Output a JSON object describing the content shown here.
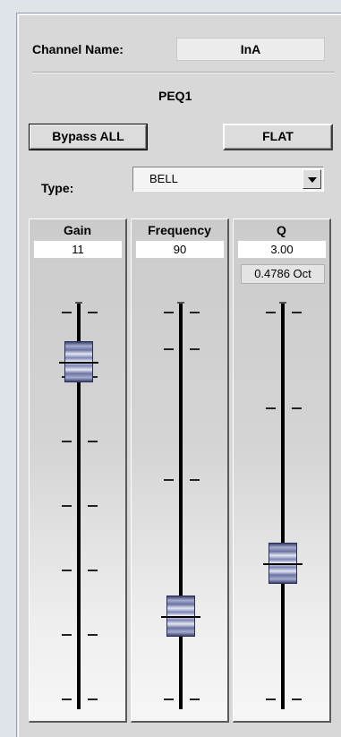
{
  "channel": {
    "label": "Channel  Name:",
    "value": "InA"
  },
  "section_title": "PEQ1",
  "buttons": {
    "bypass": "Bypass ALL",
    "flat": "FLAT"
  },
  "type": {
    "label": "Type:",
    "value": "BELL"
  },
  "faders": {
    "gain": {
      "title": "Gain",
      "value": "11",
      "level_fraction": 0.82
    },
    "frequency": {
      "title": "Frequency",
      "value": "90",
      "level_fraction": 0.21
    },
    "q": {
      "title": "Q",
      "value": "3.00",
      "extra": "0.4786 Oct",
      "level_fraction": 0.35
    }
  }
}
